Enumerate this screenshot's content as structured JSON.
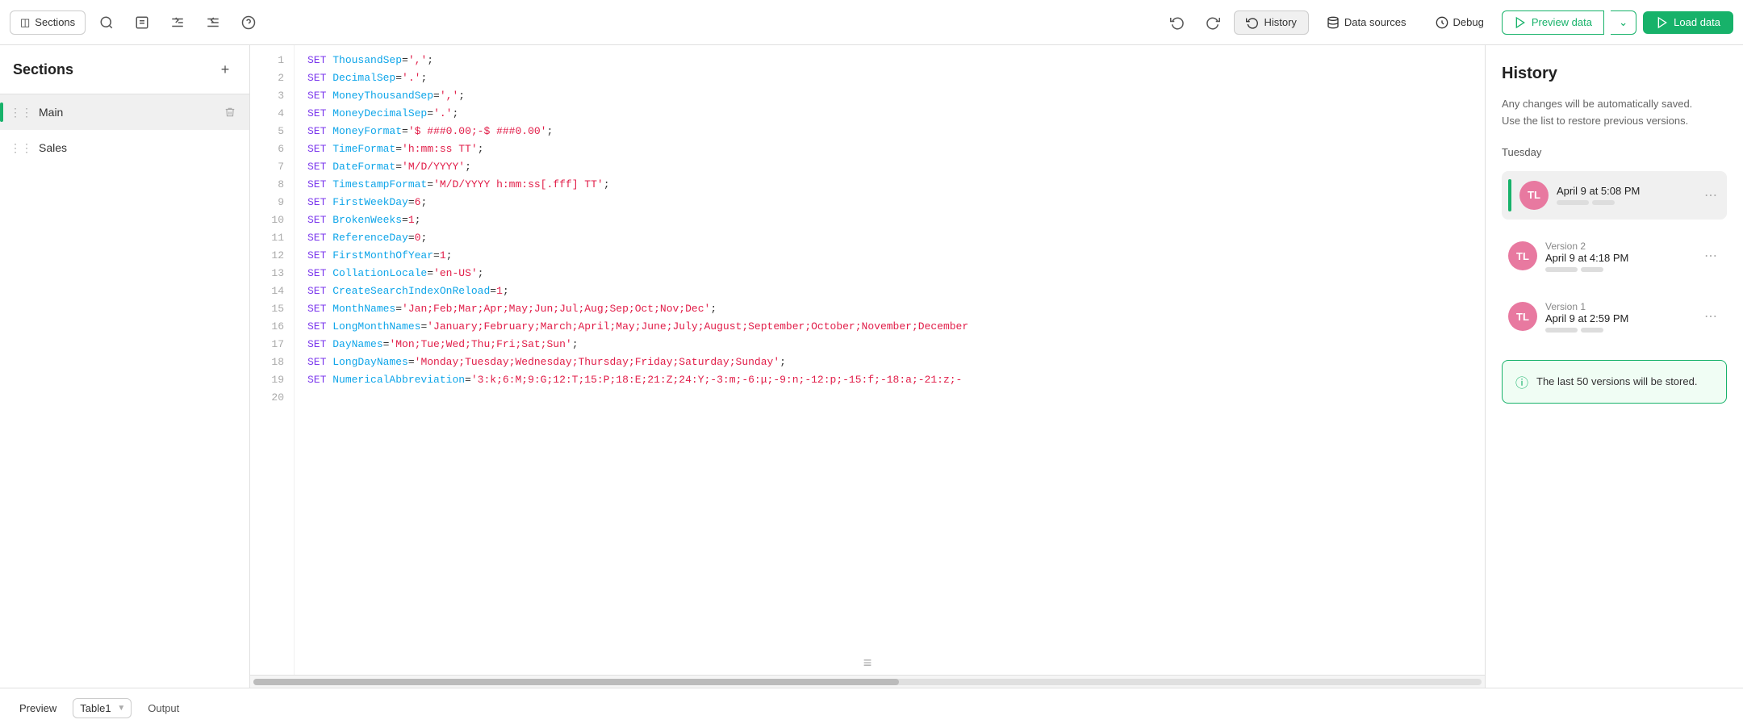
{
  "toolbar": {
    "sections_label": "Sections",
    "history_label": "History",
    "datasources_label": "Data sources",
    "debug_label": "Debug",
    "preview_label": "Preview data",
    "load_label": "Load data"
  },
  "sidebar": {
    "title": "Sections",
    "add_tooltip": "+",
    "items": [
      {
        "id": "main",
        "label": "Main",
        "active": true
      },
      {
        "id": "sales",
        "label": "Sales",
        "active": false
      }
    ]
  },
  "editor": {
    "lines": [
      {
        "n": 1,
        "code": "SET ThousandSep=',';",
        "parts": [
          [
            "kw",
            "SET "
          ],
          [
            "prop",
            "ThousandSep"
          ],
          [
            "eq",
            "="
          ],
          [
            "val",
            "','"
          ],
          [
            "eq",
            ";"
          ]
        ]
      },
      {
        "n": 2,
        "code": "SET DecimalSep='.';",
        "parts": [
          [
            "kw",
            "SET "
          ],
          [
            "prop",
            "DecimalSep"
          ],
          [
            "eq",
            "="
          ],
          [
            "val",
            "'.'"
          ],
          [
            "eq",
            ";"
          ]
        ]
      },
      {
        "n": 3,
        "code": "SET MoneyThousandSep=',';",
        "parts": [
          [
            "kw",
            "SET "
          ],
          [
            "prop",
            "MoneyThousandSep"
          ],
          [
            "eq",
            "="
          ],
          [
            "val",
            "','"
          ],
          [
            "eq",
            ";"
          ]
        ]
      },
      {
        "n": 4,
        "code": "SET MoneyDecimalSep='.';",
        "parts": [
          [
            "kw",
            "SET "
          ],
          [
            "prop",
            "MoneyDecimalSep"
          ],
          [
            "eq",
            "="
          ],
          [
            "val",
            "'.'"
          ],
          [
            "eq",
            ";"
          ]
        ]
      },
      {
        "n": 5,
        "code": "SET MoneyFormat='$ ###0.00;-$ ###0.00';",
        "parts": [
          [
            "kw",
            "SET "
          ],
          [
            "prop",
            "MoneyFormat"
          ],
          [
            "eq",
            "="
          ],
          [
            "val",
            "'$ ###0.00;-$ ###0.00'"
          ],
          [
            "eq",
            ";"
          ]
        ]
      },
      {
        "n": 6,
        "code": "SET TimeFormat='h:mm:ss TT';",
        "parts": [
          [
            "kw",
            "SET "
          ],
          [
            "prop",
            "TimeFormat"
          ],
          [
            "eq",
            "="
          ],
          [
            "val",
            "'h:mm:ss TT'"
          ],
          [
            "eq",
            ";"
          ]
        ]
      },
      {
        "n": 7,
        "code": "SET DateFormat='M/D/YYYY';",
        "parts": [
          [
            "kw",
            "SET "
          ],
          [
            "prop",
            "DateFormat"
          ],
          [
            "eq",
            "="
          ],
          [
            "val",
            "'M/D/YYYY'"
          ],
          [
            "eq",
            ";"
          ]
        ]
      },
      {
        "n": 8,
        "code": "SET TimestampFormat='M/D/YYYY h:mm:ss[.fff] TT';",
        "parts": [
          [
            "kw",
            "SET "
          ],
          [
            "prop",
            "TimestampFormat"
          ],
          [
            "eq",
            "="
          ],
          [
            "val",
            "'M/D/YYYY h:mm:ss[.fff] TT'"
          ],
          [
            "eq",
            ";"
          ]
        ]
      },
      {
        "n": 9,
        "code": "SET FirstWeekDay=6;",
        "parts": [
          [
            "kw",
            "SET "
          ],
          [
            "prop",
            "FirstWeekDay"
          ],
          [
            "eq",
            "="
          ],
          [
            "val",
            "6"
          ],
          [
            "eq",
            ";"
          ]
        ]
      },
      {
        "n": 10,
        "code": "SET BrokenWeeks=1;",
        "parts": [
          [
            "kw",
            "SET "
          ],
          [
            "prop",
            "BrokenWeeks"
          ],
          [
            "eq",
            "="
          ],
          [
            "val",
            "1"
          ],
          [
            "eq",
            ";"
          ]
        ]
      },
      {
        "n": 11,
        "code": "SET ReferenceDay=0;",
        "parts": [
          [
            "kw",
            "SET "
          ],
          [
            "prop",
            "ReferenceDay"
          ],
          [
            "eq",
            "="
          ],
          [
            "val",
            "0"
          ],
          [
            "eq",
            ";"
          ]
        ]
      },
      {
        "n": 12,
        "code": "SET FirstMonthOfYear=1;",
        "parts": [
          [
            "kw",
            "SET "
          ],
          [
            "prop",
            "FirstMonthOfYear"
          ],
          [
            "eq",
            "="
          ],
          [
            "val",
            "1"
          ],
          [
            "eq",
            ";"
          ]
        ]
      },
      {
        "n": 13,
        "code": "SET CollationLocale='en-US';",
        "parts": [
          [
            "kw",
            "SET "
          ],
          [
            "prop",
            "CollationLocale"
          ],
          [
            "eq",
            "="
          ],
          [
            "val",
            "'en-US'"
          ],
          [
            "eq",
            ";"
          ]
        ]
      },
      {
        "n": 14,
        "code": "SET CreateSearchIndexOnReload=1;",
        "parts": [
          [
            "kw",
            "SET "
          ],
          [
            "prop",
            "CreateSearchIndexOnReload"
          ],
          [
            "eq",
            "="
          ],
          [
            "val",
            "1"
          ],
          [
            "eq",
            ";"
          ]
        ]
      },
      {
        "n": 15,
        "code": "SET MonthNames='Jan;Feb;Mar;Apr;May;Jun;Jul;Aug;Sep;Oct;Nov;Dec';",
        "parts": [
          [
            "kw",
            "SET "
          ],
          [
            "prop",
            "MonthNames"
          ],
          [
            "eq",
            "="
          ],
          [
            "val",
            "'Jan;Feb;Mar;Apr;May;Jun;Jul;Aug;Sep;Oct;Nov;Dec'"
          ],
          [
            "eq",
            ";"
          ]
        ]
      },
      {
        "n": 16,
        "code": "SET LongMonthNames='January;February;March;April;May;June;July;August;September;October;November;December",
        "parts": [
          [
            "kw",
            "SET "
          ],
          [
            "prop",
            "LongMonthNames"
          ],
          [
            "eq",
            "="
          ],
          [
            "val",
            "'January;February;March;April;May;June;July;August;September;October;November;December"
          ]
        ]
      },
      {
        "n": 17,
        "code": "SET DayNames='Mon;Tue;Wed;Thu;Fri;Sat;Sun';",
        "parts": [
          [
            "kw",
            "SET "
          ],
          [
            "prop",
            "DayNames"
          ],
          [
            "eq",
            "="
          ],
          [
            "val",
            "'Mon;Tue;Wed;Thu;Fri;Sat;Sun'"
          ],
          [
            "eq",
            ";"
          ]
        ]
      },
      {
        "n": 18,
        "code": "SET LongDayNames='Monday;Tuesday;Wednesday;Thursday;Friday;Saturday;Sunday';",
        "parts": [
          [
            "kw",
            "SET "
          ],
          [
            "prop",
            "LongDayNames"
          ],
          [
            "eq",
            "="
          ],
          [
            "val",
            "'Monday;Tuesday;Wednesday;Thursday;Friday;Saturday;Sunday'"
          ],
          [
            "eq",
            ";"
          ]
        ]
      },
      {
        "n": 19,
        "code": "SET NumericalAbbreviation='3:k;6:M;9:G;12:T;15:P;18:E;21:Z;24:Y;-3:m;-6:μ;-9:n;-12:p;-15:f;-18:a;-21:z;-",
        "parts": [
          [
            "kw",
            "SET "
          ],
          [
            "prop",
            "NumericalAbbreviation"
          ],
          [
            "eq",
            "="
          ],
          [
            "val",
            "'3:k;6:M;9:G;12:T;15:P;18:E;21:Z;24:Y;-3:m;-6:μ;-9:n;-12:p;-15:f;-18:a;-21:z;-"
          ]
        ]
      },
      {
        "n": 20,
        "code": "",
        "parts": []
      }
    ]
  },
  "history": {
    "title": "History",
    "subtitle_line1": "Any changes will be automatically saved.",
    "subtitle_line2": "Use the list to restore previous versions.",
    "day_label": "Tuesday",
    "versions": [
      {
        "id": "current",
        "time": "April 9 at 5:08 PM",
        "version_label": "",
        "avatar_initials": "TL",
        "active": true
      },
      {
        "id": "v2",
        "time": "April 9 at 4:18 PM",
        "version_label": "Version 2",
        "avatar_initials": "TL",
        "active": false
      },
      {
        "id": "v1",
        "time": "April 9 at 2:59 PM",
        "version_label": "Version 1",
        "avatar_initials": "TL",
        "active": false
      }
    ],
    "info_text": "The last 50 versions will be stored."
  },
  "bottom": {
    "preview_label": "Preview",
    "table_value": "Table1",
    "output_label": "Output"
  }
}
